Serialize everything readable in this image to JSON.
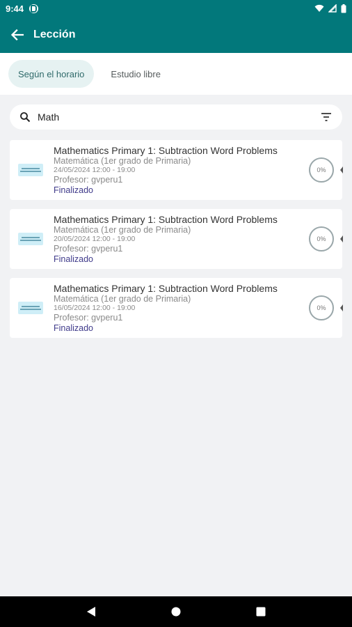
{
  "status_bar": {
    "time": "9:44"
  },
  "app_bar": {
    "title": "Lección"
  },
  "tabs": [
    {
      "label": "Según el horario",
      "active": true
    },
    {
      "label": "Estudio libre",
      "active": false
    }
  ],
  "search": {
    "value": "Math"
  },
  "lessons": [
    {
      "title": "Mathematics Primary 1: Subtraction Word Problems",
      "subject": "Matemática (1er grado de Primaria)",
      "date": "24/05/2024 12:00 - 19:00",
      "teacher": "Profesor: gvperu1",
      "status": "Finalizado",
      "progress": "0%"
    },
    {
      "title": "Mathematics Primary 1: Subtraction Word Problems",
      "subject": "Matemática (1er grado de Primaria)",
      "date": "20/05/2024 12:00 - 19:00",
      "teacher": "Profesor: gvperu1",
      "status": "Finalizado",
      "progress": "0%"
    },
    {
      "title": "Mathematics Primary 1: Subtraction Word Problems",
      "subject": "Matemática (1er grado de Primaria)",
      "date": "16/05/2024 12:00 - 19:00",
      "teacher": "Profesor: gvperu1",
      "status": "Finalizado",
      "progress": "0%"
    }
  ],
  "colors": {
    "primary": "#02787b",
    "status": "#3f3a8a",
    "tab_active_bg": "#e6f2f2"
  },
  "icons": {
    "back": "arrow-left-icon",
    "search": "search-icon",
    "filter": "filter-icon",
    "wifi": "wifi-icon",
    "signal": "signal-icon",
    "battery": "battery-icon"
  }
}
